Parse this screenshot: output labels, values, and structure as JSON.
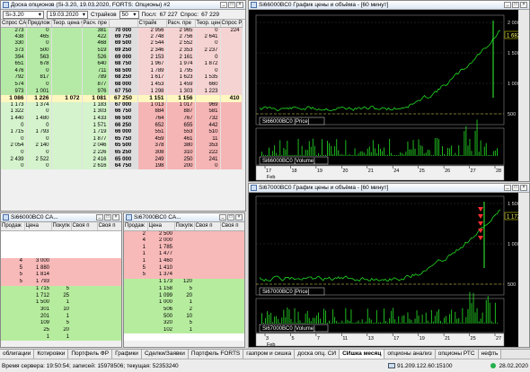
{
  "board": {
    "title": "Доска опционов (Si-3.20, 19.03.2020, FORTS: Опционы) #2",
    "underlying": "Si-3.20",
    "expiry": "19.03.2020",
    "strikes_label": "Страйков",
    "strikes_count": "50",
    "last_label": "Посл:",
    "last_value": "67 227",
    "calc_label": "Спрос:",
    "calc_value": "67 229",
    "columns": [
      "Спрос CALL",
      "Предлож",
      "Теор. цена CALL",
      "Расч. пре",
      "Страйк",
      "Расч. пре",
      "Теор. цена PUT",
      "Спрос PUT"
    ],
    "rows": [
      {
        "type": "g",
        "c1": "273",
        "c2": "0",
        "c3": "",
        "c4": "381",
        "strike": "70 000",
        "p1": "2 956",
        "p2": "2 965",
        "p3": "0",
        "p4": "224"
      },
      {
        "type": "g",
        "c1": "438",
        "c2": "465",
        "c3": "",
        "c4": "422",
        "strike": "69 750",
        "p1": "2 748",
        "p2": "2 756",
        "p3": "2 641",
        "p4": ""
      },
      {
        "type": "g",
        "c1": "330",
        "c2": "0",
        "c3": "",
        "c4": "468",
        "strike": "69 500",
        "p1": "2 544",
        "p2": "2 552",
        "p3": "0",
        "p4": ""
      },
      {
        "type": "g",
        "c1": "373",
        "c2": "500",
        "c3": "",
        "c4": "519",
        "strike": "69 250",
        "p1": "2 346",
        "p2": "2 353",
        "p3": "2 237",
        "p4": ""
      },
      {
        "type": "g",
        "c1": "394",
        "c2": "563",
        "c3": "",
        "c4": "526",
        "strike": "69 000",
        "p1": "2 153",
        "p2": "2 161",
        "p3": "0",
        "p4": ""
      },
      {
        "type": "g",
        "c1": "651",
        "c2": "678",
        "c3": "",
        "c4": "640",
        "strike": "68 750",
        "p1": "1 967",
        "p2": "1 974",
        "p3": "1 872",
        "p4": ""
      },
      {
        "type": "g",
        "c1": "476",
        "c2": "0",
        "c3": "",
        "c4": "711",
        "strike": "68 500",
        "p1": "1 789",
        "p2": "1 795",
        "p3": "0",
        "p4": ""
      },
      {
        "type": "g",
        "c1": "792",
        "c2": "817",
        "c3": "",
        "c4": "789",
        "strike": "68 250",
        "p1": "1 617",
        "p2": "1 623",
        "p3": "1 535",
        "p4": ""
      },
      {
        "type": "g",
        "c1": "574",
        "c2": "0",
        "c3": "",
        "c4": "877",
        "strike": "68 000",
        "p1": "1 453",
        "p2": "1 459",
        "p3": "660",
        "p4": ""
      },
      {
        "type": "g",
        "c1": "973",
        "c2": "1 001",
        "c3": "",
        "c4": "976",
        "strike": "67 750",
        "p1": "1 298",
        "p2": "1 303",
        "p3": "1 223",
        "p4": ""
      },
      {
        "type": "center",
        "c1": "1 086",
        "c2": "1 226",
        "c3": "",
        "c4": "1 072",
        "c5": "1 081",
        "strike": "67 250",
        "p1": "1 151",
        "p2": "1 156",
        "p3": "",
        "p4": "410"
      },
      {
        "type": "r",
        "c1": "1 173",
        "c2": "1 374",
        "c3": "",
        "c4": "1 183",
        "strike": "67 000",
        "p1": "1 013",
        "p2": "1 017",
        "p3": "969",
        "p4": ""
      },
      {
        "type": "r",
        "c1": "1 322",
        "c2": "0",
        "c3": "",
        "c4": "1 303",
        "strike": "66 750",
        "p1": "884",
        "p2": "887",
        "p3": "581",
        "p4": ""
      },
      {
        "type": "r",
        "c1": "1 440",
        "c2": "1 480",
        "c3": "",
        "c4": "1 433",
        "strike": "66 500",
        "p1": "764",
        "p2": "767",
        "p3": "732",
        "p4": ""
      },
      {
        "type": "r",
        "c1": "0",
        "c2": "0",
        "c3": "",
        "c4": "1 571",
        "strike": "66 250",
        "p1": "652",
        "p2": "655",
        "p3": "442",
        "p4": ""
      },
      {
        "type": "r",
        "c1": "1 715",
        "c2": "1 793",
        "c3": "",
        "c4": "1 719",
        "strike": "66 000",
        "p1": "551",
        "p2": "553",
        "p3": "510",
        "p4": ""
      },
      {
        "type": "r",
        "c1": "0",
        "c2": "0",
        "c3": "",
        "c4": "1 877",
        "strike": "65 750",
        "p1": "459",
        "p2": "461",
        "p3": "11",
        "p4": ""
      },
      {
        "type": "r",
        "c1": "2 054",
        "c2": "2 140",
        "c3": "",
        "c4": "2 046",
        "strike": "65 500",
        "p1": "378",
        "p2": "380",
        "p3": "353",
        "p4": ""
      },
      {
        "type": "r",
        "c1": "0",
        "c2": "0",
        "c3": "",
        "c4": "2 226",
        "strike": "65 250",
        "p1": "308",
        "p2": "310",
        "p3": "222",
        "p4": ""
      },
      {
        "type": "r",
        "c1": "2 439",
        "c2": "2 522",
        "c3": "",
        "c4": "2 416",
        "strike": "65 000",
        "p1": "249",
        "p2": "250",
        "p3": "241",
        "p4": ""
      },
      {
        "type": "r",
        "c1": "0",
        "c2": "0",
        "c3": "",
        "c4": "2 616",
        "strike": "64 750",
        "p1": "198",
        "p2": "200",
        "p3": "0",
        "p4": ""
      }
    ]
  },
  "orderbook1": {
    "title": "Si66000BC0 СА...",
    "columns": [
      "Продаж",
      "Цена",
      "Покупк",
      "Своя п",
      "Своя п"
    ],
    "rows": [
      {
        "type": "empty",
        "a": "",
        "b": "",
        "c": ""
      },
      {
        "type": "empty",
        "a": "",
        "b": "",
        "c": ""
      },
      {
        "type": "empty",
        "a": "",
        "b": "",
        "c": ""
      },
      {
        "type": "empty",
        "a": "",
        "b": "",
        "c": ""
      },
      {
        "type": "ask",
        "a": "4",
        "b": "3 000",
        "c": ""
      },
      {
        "type": "ask",
        "a": "5",
        "b": "1 880",
        "c": ""
      },
      {
        "type": "ask",
        "a": "5",
        "b": "1 814",
        "c": ""
      },
      {
        "type": "ask",
        "a": "5",
        "b": "1 793",
        "c": ""
      },
      {
        "type": "bid",
        "a": "",
        "b": "1 715",
        "c": "5"
      },
      {
        "type": "bid",
        "a": "",
        "b": "1 712",
        "c": "25"
      },
      {
        "type": "bid",
        "a": "",
        "b": "1 500",
        "c": "1"
      },
      {
        "type": "bid",
        "a": "",
        "b": "301",
        "c": "10"
      },
      {
        "type": "bid",
        "a": "",
        "b": "201",
        "c": "1"
      },
      {
        "type": "bid",
        "a": "",
        "b": "109",
        "c": "5"
      },
      {
        "type": "bid",
        "a": "",
        "b": "25",
        "c": "20"
      },
      {
        "type": "bid",
        "a": "",
        "b": "1",
        "c": "1"
      }
    ]
  },
  "orderbook2": {
    "title": "Si67000BC0 СА...",
    "columns": [
      "Продаж",
      "Цена",
      "Покупк",
      "Своя п",
      "Своя п"
    ],
    "rows": [
      {
        "type": "ask",
        "a": "2",
        "b": "2 500",
        "c": ""
      },
      {
        "type": "ask",
        "a": "4",
        "b": "2 000",
        "c": ""
      },
      {
        "type": "ask",
        "a": "1",
        "b": "1 785",
        "c": ""
      },
      {
        "type": "ask",
        "a": "1",
        "b": "1 477",
        "c": ""
      },
      {
        "type": "ask",
        "a": "1",
        "b": "1 460",
        "c": ""
      },
      {
        "type": "ask",
        "a": "5",
        "b": "1 410",
        "c": ""
      },
      {
        "type": "ask",
        "a": "5",
        "b": "1 374",
        "c": ""
      },
      {
        "type": "bid",
        "a": "",
        "b": "1 173",
        "c": "120"
      },
      {
        "type": "bid",
        "a": "",
        "b": "1 158",
        "c": "5"
      },
      {
        "type": "bid",
        "a": "",
        "b": "1 099",
        "c": "20"
      },
      {
        "type": "bid",
        "a": "",
        "b": "1 000",
        "c": "1"
      },
      {
        "type": "bid",
        "a": "",
        "b": "506",
        "c": "2"
      },
      {
        "type": "bid",
        "a": "",
        "b": "500",
        "c": "10"
      },
      {
        "type": "bid",
        "a": "",
        "b": "320",
        "c": "5"
      },
      {
        "type": "bid",
        "a": "",
        "b": "102",
        "c": "1"
      },
      {
        "type": "empty",
        "a": "",
        "b": "",
        "c": ""
      }
    ]
  },
  "chart1": {
    "title": "Si66000BC0 График цены и объёма - [60 минут]",
    "price_label": "Si66000BC0 [Price]",
    "volume_label": "Si66000BC0 [Volume]",
    "last_price": "1 682",
    "y_ticks": [
      "2 000",
      "1 500",
      "1 000",
      "500"
    ],
    "x_ticks": [
      "17",
      "18",
      "19",
      "20",
      "21",
      "24",
      "25",
      "26",
      "27",
      "28"
    ],
    "month": "Feb"
  },
  "chart2": {
    "title": "Si67000BC0 График цены и объёма - [60 минут]",
    "price_label": "Si67000BC0 [Price]",
    "volume_label": "Si67000BC0 [Volume]",
    "last_price": "1 173",
    "y_ticks": [
      "1 500",
      "1 000",
      "500"
    ],
    "x_ticks": [
      "3",
      "5",
      "7",
      "11",
      "13",
      "17",
      "19",
      "21",
      "25",
      "27"
    ],
    "month": "Feb"
  },
  "tabs": [
    "облигации",
    "Котировки",
    "Портфель ФР",
    "Графики",
    "Сделки/Заявки",
    "Портфель FORTS",
    "газпром и сишка",
    "доска опц. СИ",
    "СИшка месяц",
    "опционы анализ",
    "опционы РТС",
    "нефть"
  ],
  "active_tab": 8,
  "status": {
    "server_time": "Время сервера: 19:50:54; записей: 15978506; текущая: 52353240",
    "ip": "91.209.122.60:15100",
    "date": "28.02.2020"
  }
}
